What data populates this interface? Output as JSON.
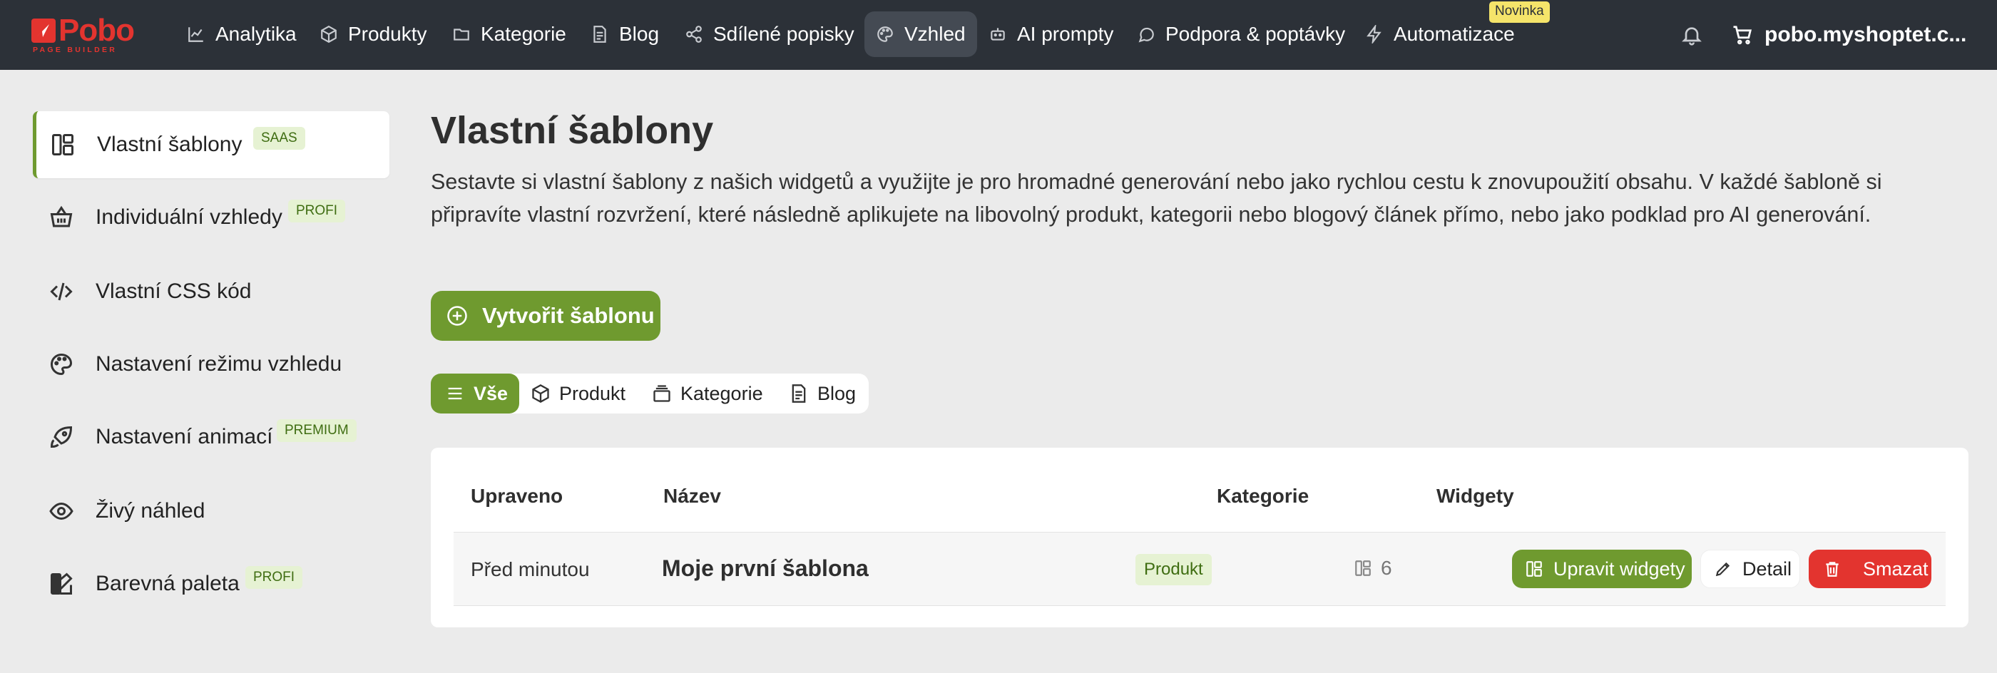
{
  "brand": {
    "name": "Pobo",
    "tagline": "PAGE BUILDER"
  },
  "nav": {
    "items": [
      {
        "label": "Analytika",
        "icon": "chart-line-icon"
      },
      {
        "label": "Produkty",
        "icon": "box-icon"
      },
      {
        "label": "Kategorie",
        "icon": "folder-icon"
      },
      {
        "label": "Blog",
        "icon": "document-icon"
      },
      {
        "label": "Sdílené popisky",
        "icon": "share-icon"
      },
      {
        "label": "Vzhled",
        "icon": "palette-icon",
        "active": true
      },
      {
        "label": "AI prompty",
        "icon": "robot-icon"
      },
      {
        "label": "Podpora & poptávky",
        "icon": "chat-bubble-icon"
      },
      {
        "label": "Automatizace",
        "icon": "lightning-icon",
        "badge": "Novinka"
      }
    ],
    "shop_label": "pobo.myshoptet.c..."
  },
  "sidebar": {
    "items": [
      {
        "label": "Vlastní šablony",
        "tag": "SAAS",
        "icon": "layout-icon",
        "active": true
      },
      {
        "label": "Individuální vzhledy",
        "tag": "PROFI",
        "icon": "basket-icon"
      },
      {
        "label": "Vlastní CSS kód",
        "tag": "",
        "icon": "code-icon"
      },
      {
        "label": "Nastavení režimu vzhledu",
        "tag": "",
        "icon": "palette-icon"
      },
      {
        "label": "Nastavení animací",
        "tag": "PREMIUM",
        "icon": "rocket-icon"
      },
      {
        "label": "Živý náhled",
        "tag": "",
        "icon": "eye-icon"
      },
      {
        "label": "Barevná paleta",
        "tag": "PROFI",
        "icon": "swatch-icon"
      }
    ]
  },
  "main": {
    "title": "Vlastní šablony",
    "description": "Sestavte si vlastní šablony z našich widgetů a využijte je pro hromadné generování nebo jako rychlou cestu k znovupoužití obsahu. V každé šabloně si připravíte vlastní rozvržení, které následně aplikujete na libovolný produkt, kategorii nebo blogový článek přímo, nebo jako podklad pro AI generování.",
    "create_label": "Vytvořit šablonu",
    "filters": [
      {
        "label": "Vše",
        "active": true
      },
      {
        "label": "Produkt"
      },
      {
        "label": "Kategorie"
      },
      {
        "label": "Blog"
      }
    ]
  },
  "table": {
    "headers": {
      "updated": "Upraveno",
      "name": "Název",
      "category": "Kategorie",
      "widgets": "Widgety"
    },
    "rows": [
      {
        "updated": "Před minutou",
        "name": "Moje první šablona",
        "category": "Produkt",
        "widgets": "6",
        "edit_label": "Upravit widgety",
        "detail_label": "Detail",
        "delete_label": "Smazat"
      }
    ]
  },
  "colors": {
    "topbar": "#2c3138",
    "accent_green": "#6f9a2f",
    "danger_red": "#e3342f",
    "brand_red": "#e3342f",
    "badge_yellow": "#f5e46a",
    "background": "#ebebeb"
  }
}
